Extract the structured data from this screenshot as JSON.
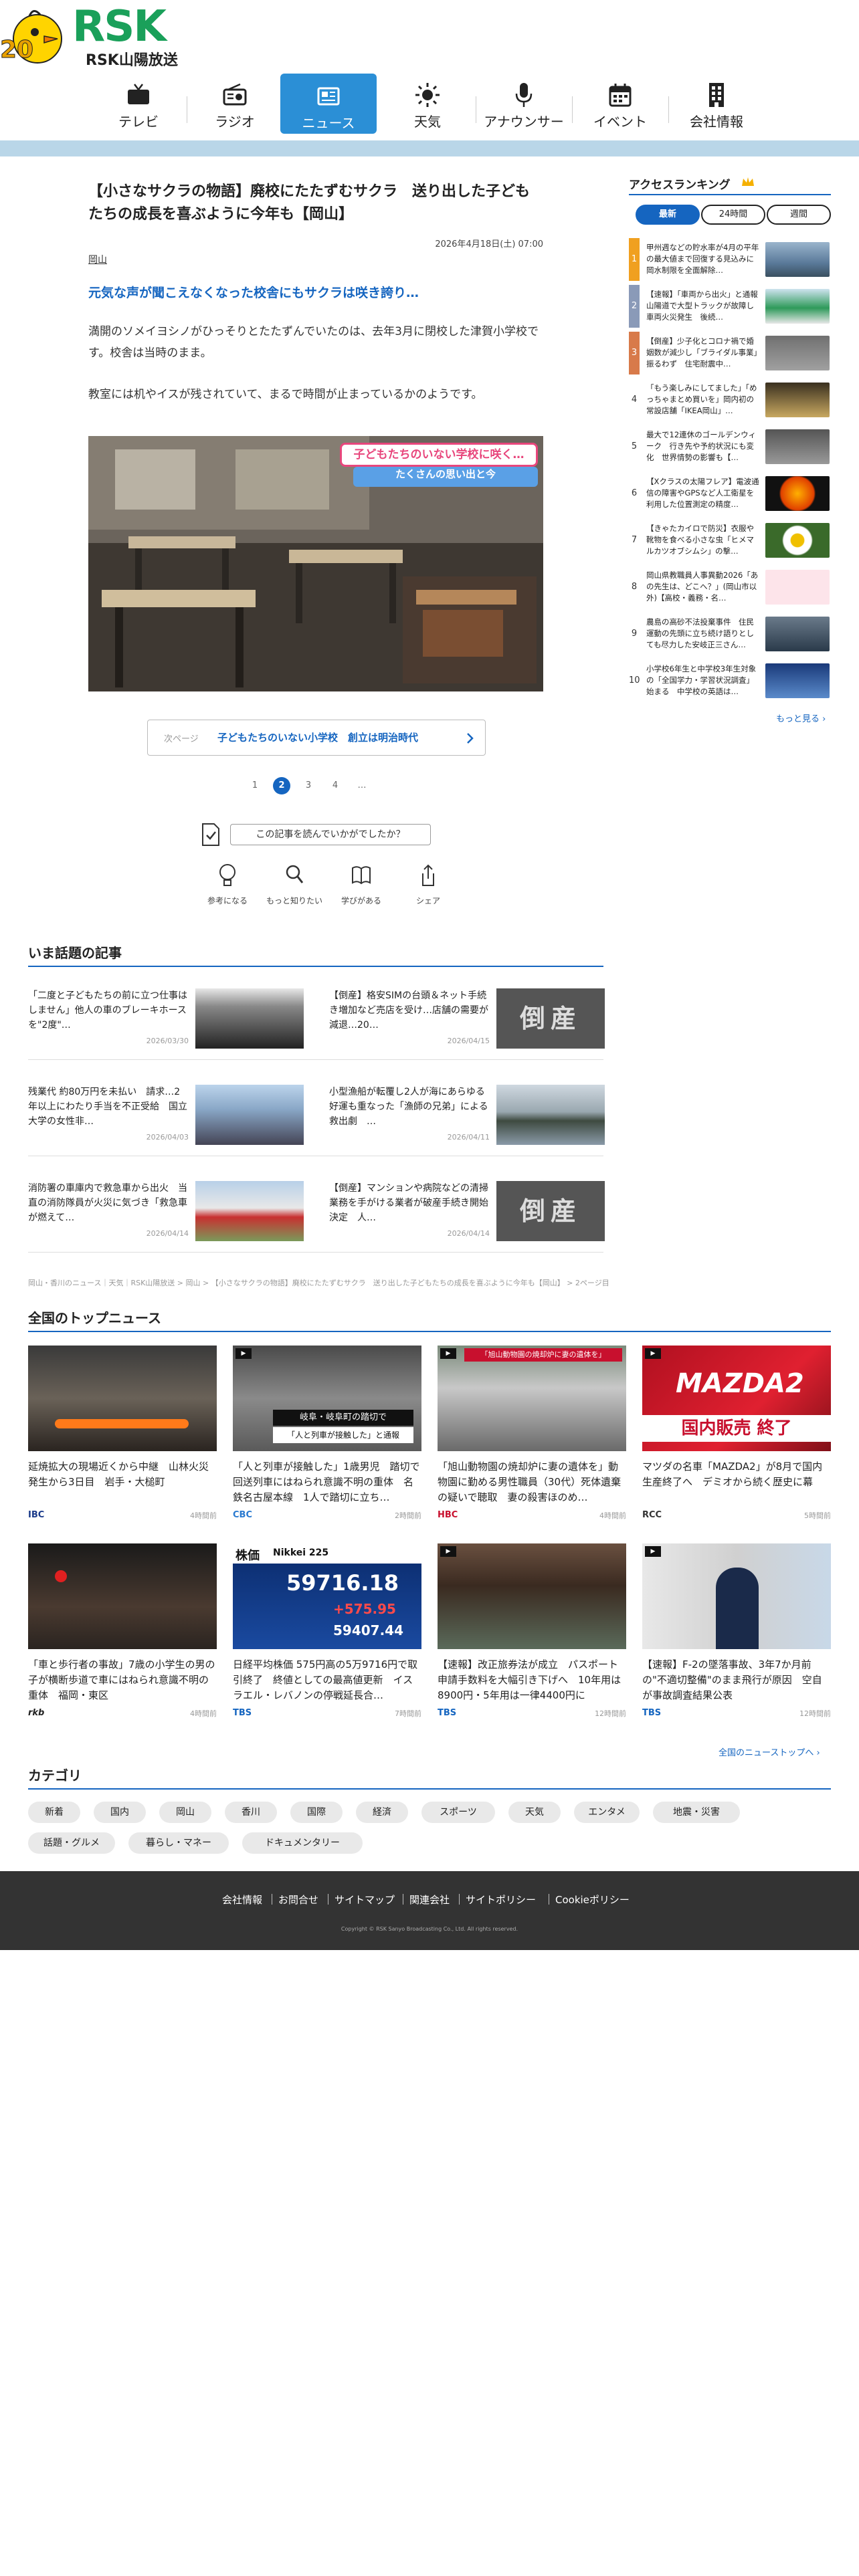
{
  "brand": {
    "logo_text": "RSK",
    "sub_text": "RSK山陽放送",
    "anniversary": "20",
    "accent": "#1565c0",
    "green": "#1aa05a"
  },
  "nav": [
    {
      "label": "テレビ",
      "icon": "tv-icon"
    },
    {
      "label": "ラジオ",
      "icon": "radio-icon"
    },
    {
      "label": "ニュース",
      "icon": "news-icon",
      "active": true
    },
    {
      "label": "天気",
      "icon": "sun-icon"
    },
    {
      "label": "アナウンサー",
      "icon": "microphone-icon"
    },
    {
      "label": "イベント",
      "icon": "calendar-icon"
    },
    {
      "label": "会社情報",
      "icon": "building-icon"
    }
  ],
  "article": {
    "title": "【小さなサクラの物語】廃校にたたずむサクラ　送り出した子どもたちの成長を喜ぶように今年も【岡山】",
    "date": "2026年4月18日(土) 07:00",
    "location": "岡山",
    "lead": "元気な声が聞こえなくなった校舎にもサクラは咲き誇り…",
    "p1": "満開のソメイヨシノがひっそりとたたずんでいたのは、去年3月に閉校した津賀小学校です。校舎は当時のまま。",
    "p2": "教室には机やイスが残されていて、まるで時間が止まっているかのようです。",
    "caption_main": "子どもたちのいない学校に咲く…",
    "caption_sub": "たくさんの思い出と今",
    "next_label": "次ページ",
    "next_title": "子どもたちのいない小学校　創立は明治時代",
    "pages": [
      "1",
      "2",
      "3",
      "4",
      "…"
    ],
    "current_page": "2",
    "ask": "この記事を読んでいかがでしたか？",
    "reactions": [
      {
        "label": "参考になる",
        "icon": "lightbulb-icon"
      },
      {
        "label": "もっと知りたい",
        "icon": "magnifier-icon"
      },
      {
        "label": "学びがある",
        "icon": "book-icon"
      },
      {
        "label": "シェア",
        "icon": "share-icon"
      }
    ]
  },
  "ranking": {
    "title": "アクセスランキング",
    "tabs": [
      "最新",
      "24時間",
      "週間"
    ],
    "items": [
      {
        "no": "1",
        "text": "甲州週などの貯水率が4月の平年の最大値まで回復する見込みに　岡水制限を全面解除…"
      },
      {
        "no": "2",
        "text": "【速報】「車両から出火」と通報　山陽道で大型トラックが故障し車両火災発生　後続…"
      },
      {
        "no": "3",
        "text": "【倒産】少子化とコロナ禍で婚姻数が減少し「ブライダル事業」振るわず　住宅耐震中…"
      },
      {
        "no": "4",
        "text": "「もう楽しみにしてました」「めっちゃまとめ買いを」岡内初の常設店舗「IKEA岡山」…"
      },
      {
        "no": "5",
        "text": "最大で12連休のゴールデンウィーク　行き先や予約状況にも変化　世界情勢の影響も【…"
      },
      {
        "no": "6",
        "text": "【Xクラスの太陽フレア】電波通信の障害やGPSなど人工衛星を利用した位置測定の精度…"
      },
      {
        "no": "7",
        "text": "【きゃたカイロで防災】衣服や靴物を食べる小さな虫「ヒメマルカツオブシムシ」の撃…"
      },
      {
        "no": "8",
        "text": "岡山県教職員人事異動2026「あの先生は、どこへ？」(岡山市以外)【高校・義務・名…"
      },
      {
        "no": "9",
        "text": "農島の高砂不法投棄事件　住民運動の先頭に立ち続け語りとしても尽力した安岐正三さん…"
      },
      {
        "no": "10",
        "text": "小学校6年生と中学校3年生対象の「全国学力・学習状況調査」始まる　中学校の英語は…"
      }
    ],
    "more": "もっと見る"
  },
  "popular": {
    "title": "いま話題の記事",
    "items": [
      {
        "title": "「二度と子どもたちの前に立つ仕事はしません」他人の車のブレーキホースを\"2度\"…",
        "date": "2026/03/30"
      },
      {
        "title": "【倒産】格安SIMの台頭＆ネット手続き増加など売店を受け…店舗の需要が減退…20…",
        "date": "2026/04/15"
      },
      {
        "title": "残業代 約80万円を未払い　請求…2年以上にわたり手当を不正受給　国立大学の女性非…",
        "date": "2026/04/03"
      },
      {
        "title": "小型漁船が転覆し2人が海にあらゆる好運も重なった「漁師の兄弟」による救出劇　…",
        "date": "2026/04/11"
      },
      {
        "title": "消防署の車庫内で救急車から出火　当直の消防隊員が火災に気づき「救急車が燃えて…",
        "date": "2026/04/14"
      },
      {
        "title": "【倒産】マンションや病院などの清掃業務を手がける業者が破産手続き開始決定　人…",
        "date": "2026/04/14"
      }
    ],
    "stamp": "倒産"
  },
  "breadcrumb": "岡山・香川のニュース｜天気｜RSK山陽放送 > 岡山 > 【小さなサクラの物語】廃校にたたずむサクラ　送り出した子どもたちの成長を喜ぶように今年も【岡山】 > 2ページ目",
  "topnews": {
    "title": "全国のトップニュース",
    "items": [
      {
        "title": "延焼拡大の現場近くから中継　山林火災発生から3日目　岩手・大槌町",
        "source": "IBC",
        "age": "4時間前",
        "color": "#1a3a8a"
      },
      {
        "title": "「人と列車が接触した」1歳男児　踏切で回送列車にはねられ意識不明の重体　名鉄名古屋本線　1人で踏切に立ち…",
        "source": "CBC",
        "age": "2時間前",
        "color": "#2a7ad0"
      },
      {
        "title": "「旭山動物園の焼却炉に妻の遺体を」動物園に勤める男性職員（30代）死体遺棄の疑いで聴取　妻の殺害ほのめ…",
        "source": "HBC",
        "age": "4時間前",
        "color": "#c8102e"
      },
      {
        "title": "マツダの名車「MAZDA2」が8月で国内生産終了へ　デミオから続く歴史に幕",
        "source": "RCC",
        "age": "5時間前",
        "color": "#333333"
      },
      {
        "title": "「車と歩行者の事故」7歳の小学生の男の子が横断歩道で車にはねられ意識不明の重体　福岡・東区",
        "source": "rkb",
        "age": "4時間前",
        "color": "#222222"
      },
      {
        "title": "日経平均株価 575円高の5万9716円で取引終了　終値としての最高値更新　イスラエル・レバノンの停戦延長合…",
        "source": "TBS",
        "age": "7時間前",
        "color": "#1565c0"
      },
      {
        "title": "【速報】改正旅券法が成立　パスポート申請手数料を大幅引き下げへ　10年用は8900円・5年用は一律4400円に",
        "source": "TBS",
        "age": "12時間前",
        "color": "#1565c0"
      },
      {
        "title": "【速報】F-2の墜落事故、3年7か月前の\"不適切整備\"のまま飛行が原因　空自が事故調査結果公表",
        "source": "TBS",
        "age": "12時間前",
        "color": "#1565c0"
      }
    ],
    "img_texts": {
      "mazda": "MAZDA2",
      "mazda_band": "国内販売 終了",
      "stock_label": "株価",
      "stock_index": "Nikkei 225",
      "stock_value": "59716.18",
      "stock_change": "+575.95",
      "stock_prev": "59407.44",
      "cbc_cap1": "岐阜・岐阜町の踏切で",
      "cbc_cap2": "「人と列車が接触した」と通報",
      "hbc_cap": "「旭山動物園の焼却炉に妻の遺体を」"
    },
    "more": "全国のニューストップへ"
  },
  "categories": {
    "title": "カテゴリ",
    "items": [
      "新着",
      "国内",
      "岡山",
      "香川",
      "国際",
      "経済",
      "スポーツ",
      "天気",
      "エンタメ",
      "地震・災害",
      "話題・グルメ",
      "暮らし・マネー",
      "ドキュメンタリー"
    ]
  },
  "footer": {
    "links": [
      "会社情報",
      "お問合せ",
      "サイトマップ",
      "関連会社",
      "サイトポリシー",
      "Cookieポリシー"
    ],
    "copyright": "Copyright © RSK Sanyo Broadcasting Co., Ltd. All rights reserved."
  }
}
